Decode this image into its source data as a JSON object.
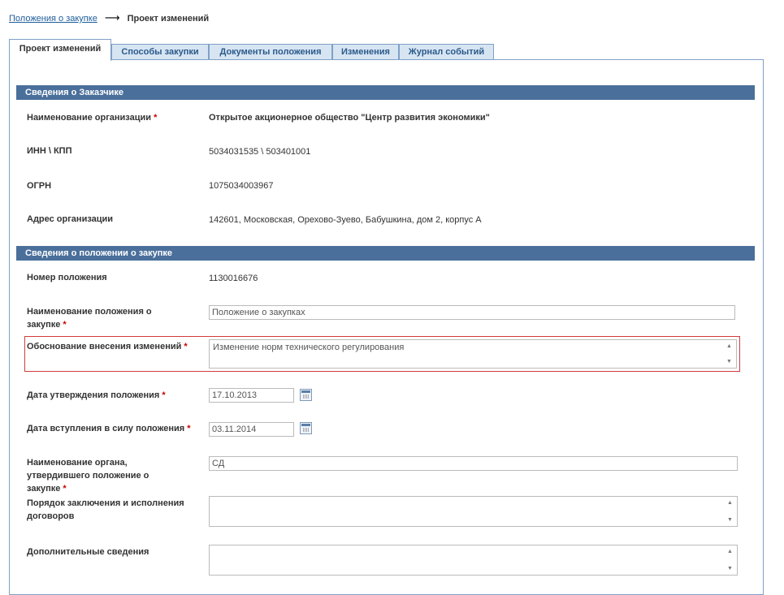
{
  "breadcrumb": {
    "parent": "Положения о закупке",
    "arrow": "⟶",
    "current": "Проект изменений"
  },
  "tabs": [
    {
      "label": "Проект изменений",
      "active": true
    },
    {
      "label": "Способы закупки"
    },
    {
      "label": "Документы положения"
    },
    {
      "label": "Изменения"
    },
    {
      "label": "Журнал событий"
    }
  ],
  "customer": {
    "title": "Сведения о Заказчике",
    "org_name_label": "Наименование организации",
    "org_name": "Открытое акционерное общество \"Центр развития экономики\"",
    "inn_kpp_label": "ИНН \\ КПП",
    "inn_kpp": "5034031535 \\ 503401001",
    "ogrn_label": "ОГРН",
    "ogrn": "1075034003967",
    "address_label": "Адрес организации",
    "address": "142601, Московская, Орехово-Зуево, Бабушкина, дом 2, корпус А"
  },
  "regulation": {
    "title": "Сведения о положении о закупке",
    "number_label": "Номер положения",
    "number": "1130016676",
    "name_label_1": "Наименование положения о",
    "name_label_2": "закупке",
    "name_value": "Положение о закупках",
    "reason_label": "Обоснование внесения изменений",
    "reason_value": "Изменение норм технического регулирования",
    "approve_date_label": "Дата утверждения положения",
    "approve_date": "17.10.2013",
    "effective_date_label": "Дата вступления в силу положения",
    "effective_date": "03.11.2014",
    "organ_label_1": "Наименование органа,",
    "organ_label_2": "утвердившего положение о",
    "organ_label_3": "закупке",
    "organ_value": "СД",
    "contract_order_label_1": "Порядок заключения и исполнения",
    "contract_order_label_2": "договоров",
    "contract_order_value": "",
    "extra_label": "Дополнительные сведения",
    "extra_value": ""
  },
  "required_mark": "*",
  "icons": {
    "scroll_up": "▲",
    "scroll_down": "▼"
  },
  "colors": {
    "section_header": "#4a6f9b",
    "tab_bg": "#d7e5f3",
    "required": "#cc0000",
    "highlight_border": "#d23a3a"
  }
}
